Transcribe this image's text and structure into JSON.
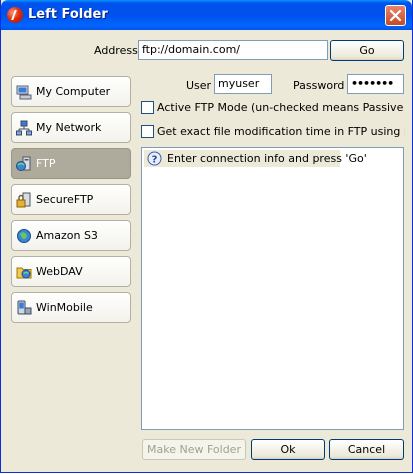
{
  "window": {
    "title": "Left Folder"
  },
  "address": {
    "label": "Address",
    "value": "ftp://domain.com/",
    "go_label": "Go"
  },
  "sidebar": {
    "items": [
      {
        "label": "My Computer",
        "icon": "computer-icon",
        "active": false
      },
      {
        "label": "My Network",
        "icon": "network-icon",
        "active": false
      },
      {
        "label": "FTP",
        "icon": "ftp-icon",
        "active": true
      },
      {
        "label": "SecureFTP",
        "icon": "secureftp-icon",
        "active": false
      },
      {
        "label": "Amazon S3",
        "icon": "amazon-s3-icon",
        "active": false
      },
      {
        "label": "WebDAV",
        "icon": "webdav-icon",
        "active": false
      },
      {
        "label": "WinMobile",
        "icon": "winmobile-icon",
        "active": false
      }
    ]
  },
  "ftp": {
    "user_label": "User",
    "user_value": "myuser",
    "password_label": "Password",
    "password_value": "•••••••",
    "active_mode_label": "Active FTP Mode (un-checked means Passive mode)",
    "active_mode_checked": false,
    "mdtm_label": "Get exact file modification time in FTP using MDTM command",
    "mdtm_checked": false
  },
  "listing": {
    "message": "Enter connection info and press 'Go'",
    "message_icon": "question-icon"
  },
  "footer": {
    "new_folder_label": "Make New Folder",
    "ok_label": "Ok",
    "cancel_label": "Cancel"
  }
}
